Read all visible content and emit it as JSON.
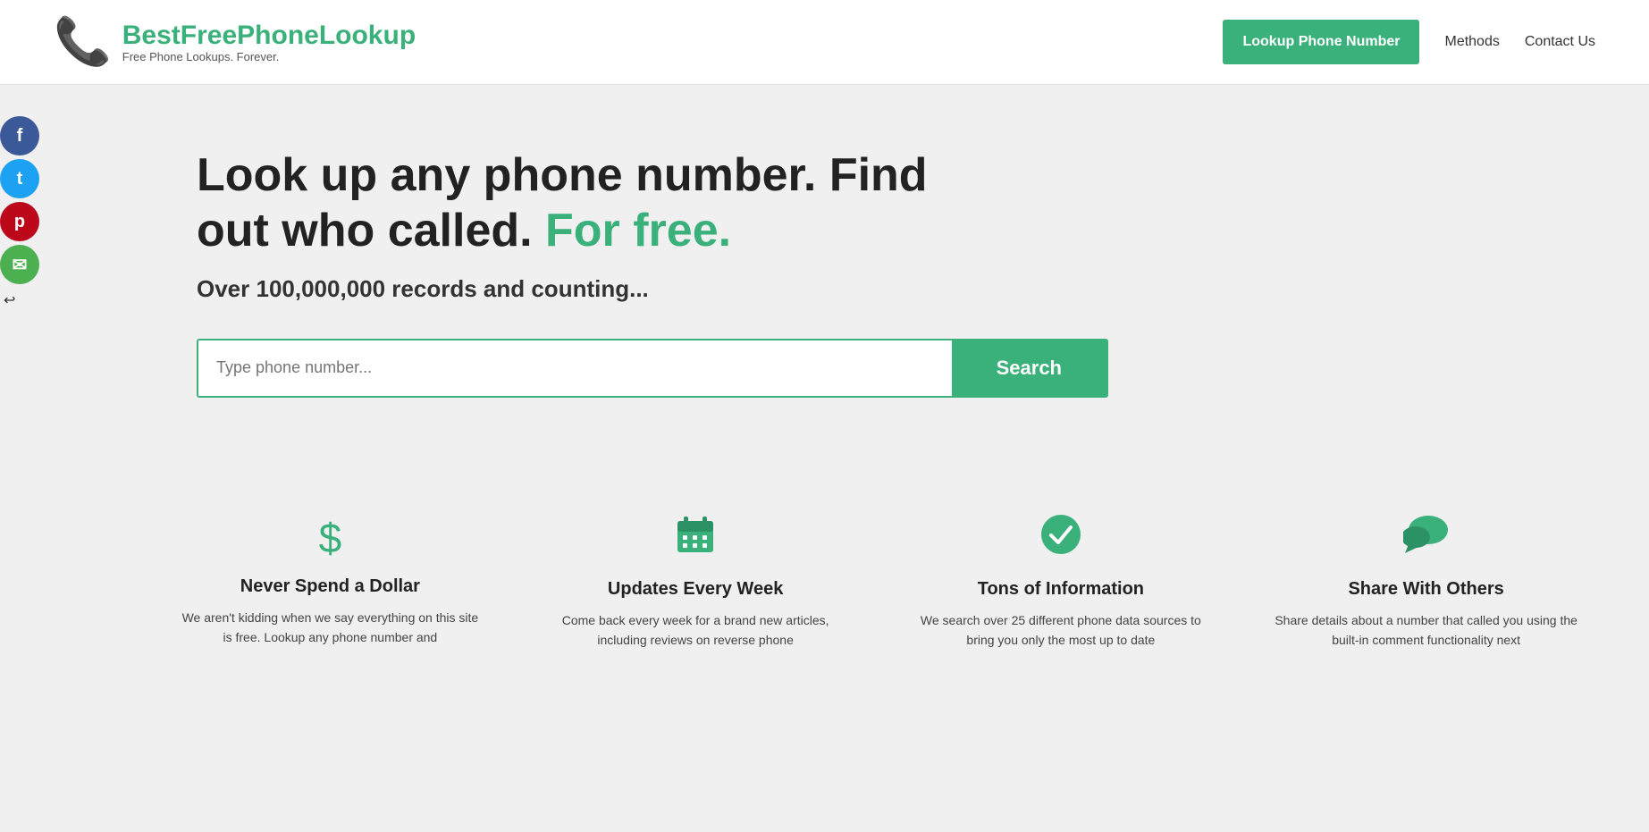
{
  "header": {
    "logo": {
      "brand_prefix": "BestFree",
      "brand_green": "Phone",
      "brand_suffix": "Lookup",
      "tagline": "Free Phone Lookups. Forever."
    },
    "nav": {
      "lookup_btn": "Lookup Phone Number",
      "methods_link": "Methods",
      "contact_link": "Contact Us"
    }
  },
  "social": {
    "facebook_label": "f",
    "twitter_label": "t",
    "pinterest_label": "p",
    "email_label": "✉",
    "arrow": "↩"
  },
  "hero": {
    "title_part1": "Look up any phone number. Find out who called. ",
    "title_highlight": "For free.",
    "subtitle": "Over 100,000,000 records and counting...",
    "search_placeholder": "Type phone number...",
    "search_button": "Search"
  },
  "features": [
    {
      "icon": "$",
      "title": "Never Spend a Dollar",
      "desc": "We aren't kidding when we say everything on this site is free. Lookup any phone number and"
    },
    {
      "icon": "📅",
      "title": "Updates Every Week",
      "desc": "Come back every week for a brand new articles, including reviews on reverse phone"
    },
    {
      "icon": "✔",
      "title": "Tons of Information",
      "desc": "We search over 25 different phone data sources to bring you only the most up to date"
    },
    {
      "icon": "💬",
      "title": "Share With Others",
      "desc": "Share details about a number that called you using the built-in comment functionality next"
    }
  ]
}
